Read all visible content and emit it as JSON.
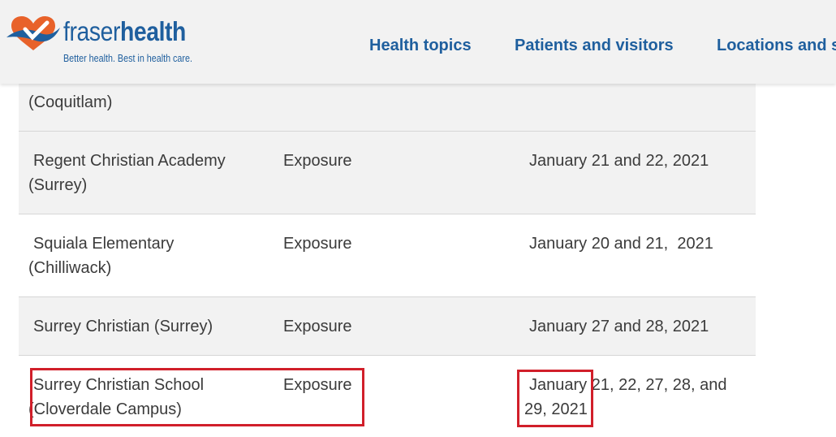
{
  "header": {
    "logo": {
      "word_light": "fraser",
      "word_bold": "health",
      "tagline": "Better health. Best in health care.",
      "colors": {
        "blue": "#1f5f9e",
        "orange": "#e8622a"
      }
    },
    "nav": [
      {
        "label": "Health topics"
      },
      {
        "label": "Patients and visitors"
      },
      {
        "label": "Locations and s"
      }
    ]
  },
  "table": {
    "rows": [
      {
        "school_line1": "",
        "school_line2": "(Coquitlam)",
        "type": "",
        "dates_line1": "",
        "dates_line2": ""
      },
      {
        "school_line1": "Regent Christian Academy",
        "school_line2": "(Surrey)",
        "type": "Exposure",
        "dates_line1": "January 21 and 22, 2021",
        "dates_line2": ""
      },
      {
        "school_line1": "Squiala Elementary",
        "school_line2": "(Chilliwack)",
        "type": "Exposure",
        "dates_line1": "January 20 and 21,  2021",
        "dates_line2": ""
      },
      {
        "school_line1": "Surrey Christian (Surrey)",
        "school_line2": "",
        "type": "Exposure",
        "dates_line1": "January 27 and 28, 2021",
        "dates_line2": ""
      },
      {
        "school_line1": "Surrey Christian School",
        "school_line2": "(Cloverdale Campus)",
        "type": "Exposure",
        "dates_line1": "January 21, 22, 27, 28, and",
        "dates_line2": "29, 2021"
      }
    ]
  },
  "annotations": {
    "highlight_color": "#d11f2a"
  }
}
